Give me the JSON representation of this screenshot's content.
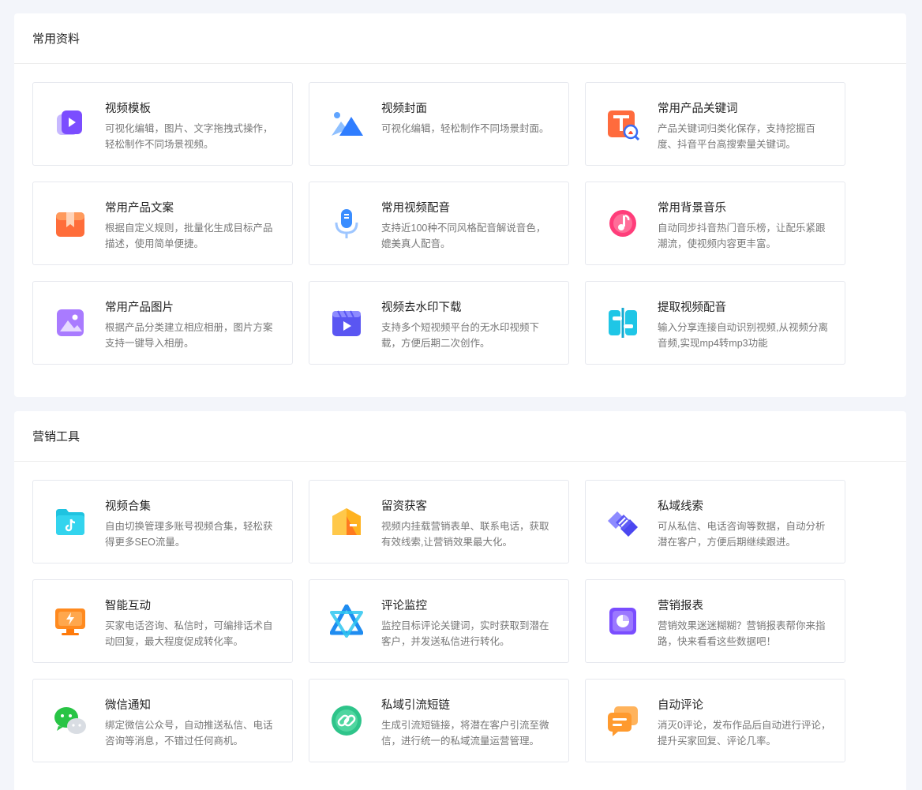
{
  "sections": [
    {
      "title": "常用资料",
      "cards": [
        {
          "icon": "video-template-icon",
          "title": "视频模板",
          "desc": "可视化编辑，图片、文字拖拽式操作，轻松制作不同场景视频。"
        },
        {
          "icon": "video-cover-icon",
          "title": "视频封面",
          "desc": "可视化编辑，轻松制作不同场景封面。"
        },
        {
          "icon": "product-keyword-icon",
          "title": "常用产品关键词",
          "desc": "产品关键词归类化保存，支持挖掘百度、抖音平台高搜索量关键词。"
        },
        {
          "icon": "product-copy-icon",
          "title": "常用产品文案",
          "desc": "根据自定义规则，批量化生成目标产品描述，使用简单便捷。"
        },
        {
          "icon": "microphone-icon",
          "title": "常用视频配音",
          "desc": "支持近100种不同风格配音解说音色，媲美真人配音。"
        },
        {
          "icon": "music-note-icon",
          "title": "常用背景音乐",
          "desc": "自动同步抖音热门音乐榜，让配乐紧跟潮流，使视频内容更丰富。"
        },
        {
          "icon": "image-gallery-icon",
          "title": "常用产品图片",
          "desc": "根据产品分类建立相应相册，图片方案支持一键导入相册。"
        },
        {
          "icon": "video-download-icon",
          "title": "视频去水印下载",
          "desc": "支持多个短视频平台的无水印视频下载，方便后期二次创作。"
        },
        {
          "icon": "audio-extract-icon",
          "title": "提取视频配音",
          "desc": "输入分享连接自动识别视频,从视频分离音频,实现mp4转mp3功能"
        }
      ]
    },
    {
      "title": "营销工具",
      "cards": [
        {
          "icon": "video-collection-icon",
          "title": "视频合集",
          "desc": "自由切换管理多账号视频合集，轻松获得更多SEO流量。"
        },
        {
          "icon": "lead-capture-icon",
          "title": "留资获客",
          "desc": "视频内挂载营销表单、联系电话，获取有效线索,让营销效果最大化。"
        },
        {
          "icon": "handshake-icon",
          "title": "私域线索",
          "desc": "可从私信、电话咨询等数据，自动分析潜在客户，方便后期继续跟进。"
        },
        {
          "icon": "smart-interaction-icon",
          "title": "智能互动",
          "desc": "买家电话咨询、私信时，可编排话术自动回复，最大程度促成转化率。"
        },
        {
          "icon": "comment-monitor-icon",
          "title": "评论监控",
          "desc": "监控目标评论关键词，实时获取到潜在客户，并发送私信进行转化。"
        },
        {
          "icon": "marketing-report-icon",
          "title": "营销报表",
          "desc": "营销效果迷迷糊糊？营销报表帮你来指路，快来看看这些数据吧！"
        },
        {
          "icon": "wechat-icon",
          "title": "微信通知",
          "desc": "绑定微信公众号，自动推送私信、电话咨询等消息，不错过任何商机。"
        },
        {
          "icon": "link-icon",
          "title": "私域引流短链",
          "desc": "生成引流短链接，将潜在客户引流至微信，进行统一的私域流量运营管理。"
        },
        {
          "icon": "auto-comment-icon",
          "title": "自动评论",
          "desc": "消灭0评论，发布作品后自动进行评论，提升买家回复、评论几率。"
        }
      ]
    }
  ]
}
